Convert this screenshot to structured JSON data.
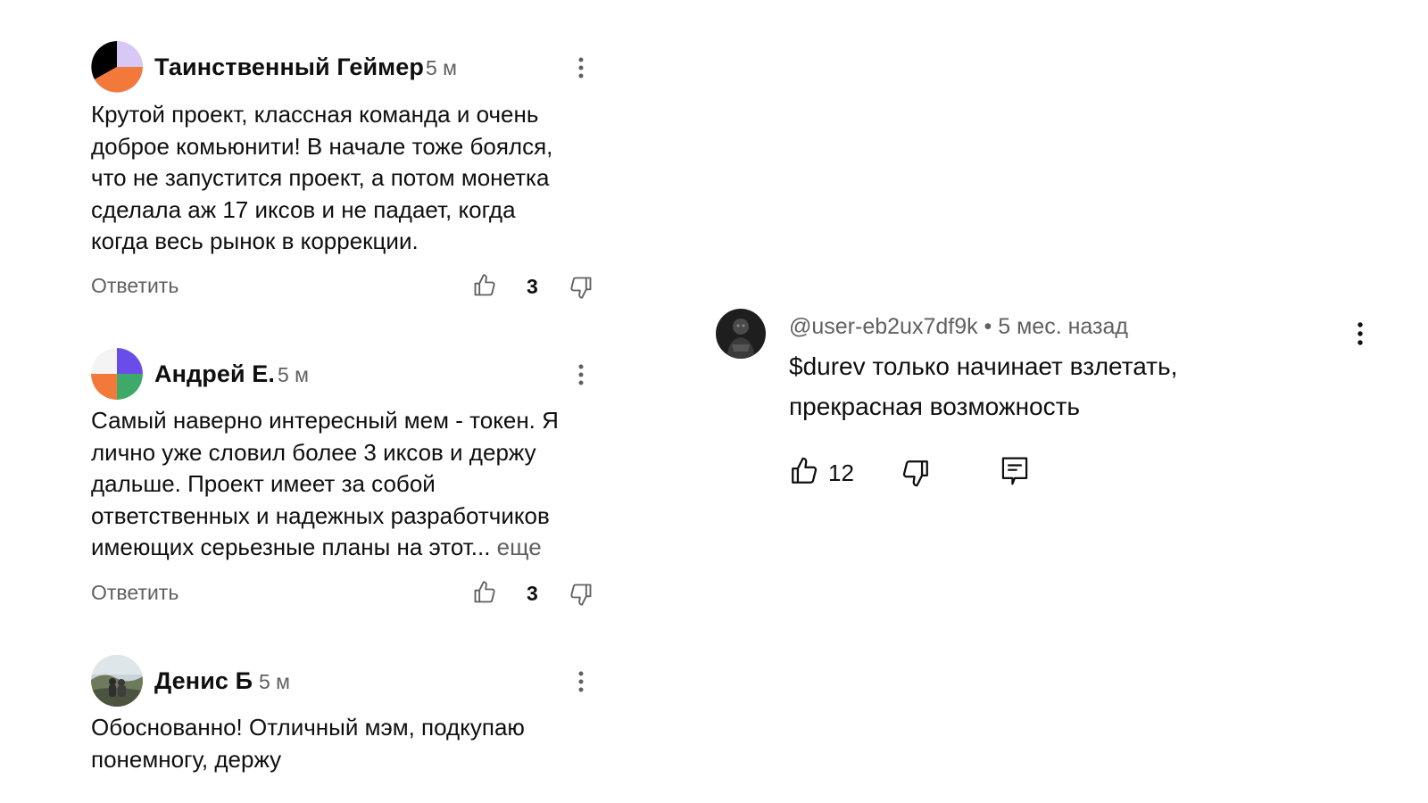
{
  "left_comments": [
    {
      "author": "Таинственный Геймер",
      "time": "5 м",
      "text_lines": [
        "Крутой проект, классная команда и очень",
        "доброе комьюнити! В начале тоже боялся,",
        "что не запустится проект, а потом монетка",
        "сделала аж 17 иксов и не падает, когда",
        "когда весь рынок в коррекции."
      ],
      "reply_label": "Ответить",
      "likes": "3"
    },
    {
      "author": "Андрей Е.",
      "time": "5 м",
      "text_lines": [
        "Самый наверно интересный мем - токен. Я",
        "лично уже словил более 3 иксов и держу",
        "дальше. Проект имеет за собой",
        "ответственных и надежных разработчиков",
        "имеющих серьезные планы на этот..."
      ],
      "more_label": "еще",
      "reply_label": "Ответить",
      "likes": "3"
    },
    {
      "author": "Денис Б",
      "time": "5 м",
      "text_lines": [
        "Обоснованно! Отличный мэм, подкупаю",
        "понемногу, держу"
      ]
    }
  ],
  "right_comment": {
    "handle": "@user-eb2ux7df9k • 5 мес. назад",
    "text_lines": [
      "$durev только начинает взлетать,",
      "прекрасная возможность"
    ],
    "likes": "12"
  },
  "colors": {
    "text": "#0f0f0f",
    "secondary": "#606060",
    "avatar1": [
      "#000000",
      "#d7c8f5",
      "#f2793a"
    ],
    "avatar2": [
      "#6a4de8",
      "#3eaa6a",
      "#f2793a",
      "#f4f4f4"
    ]
  },
  "icons": [
    "kebab-icon",
    "thumb-up-icon",
    "thumb-down-icon",
    "reply-comment-icon"
  ]
}
